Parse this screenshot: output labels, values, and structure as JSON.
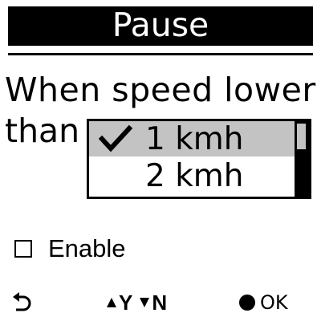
{
  "header": {
    "title": "Pause"
  },
  "prompt": {
    "line1": "When speed lower",
    "line2": "than"
  },
  "speed_list": {
    "options": [
      {
        "label": "1 kmh",
        "selected": true
      },
      {
        "label": "2 kmh",
        "selected": false
      }
    ]
  },
  "enable": {
    "label": "Enable",
    "checked": false
  },
  "footer": {
    "yes_letter": "Y",
    "no_letter": "N",
    "ok_label": "OK"
  },
  "icons": {
    "check": "check-icon",
    "back": "back-arrow-icon",
    "up": "triangle-up-icon",
    "down": "triangle-down-icon",
    "ok": "filled-dot-icon",
    "checkbox": "checkbox-icon"
  },
  "colors": {
    "background": "#ffffff",
    "foreground": "#000000",
    "highlight": "#c3c3c3"
  }
}
